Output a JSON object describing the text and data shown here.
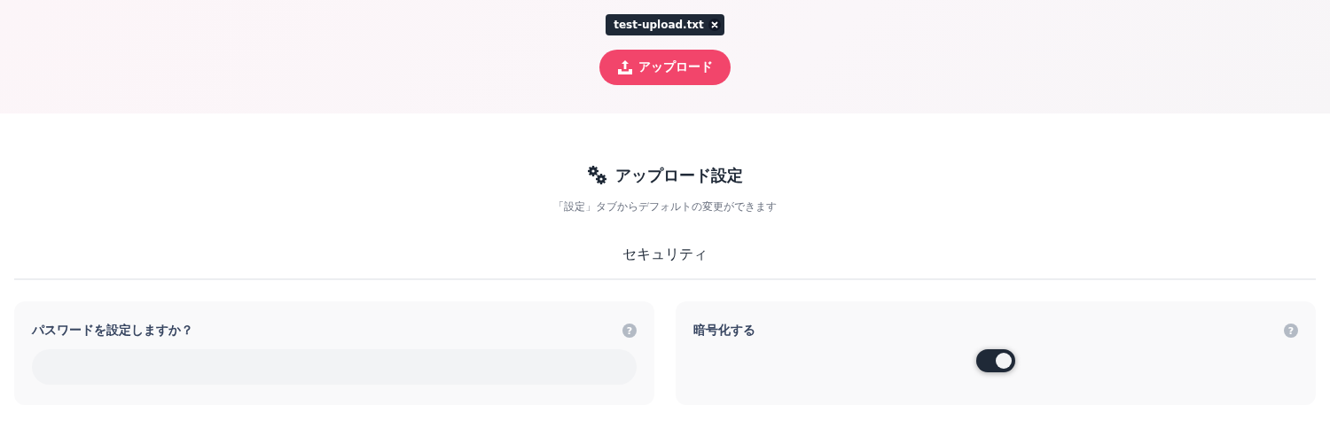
{
  "file_chip": {
    "name": "test-upload.txt"
  },
  "upload_button": {
    "label": "アップロード"
  },
  "settings": {
    "title": "アップロード設定",
    "subtitle": "「設定」タブからデフォルトの変更ができます",
    "section": "セキュリティ",
    "cards": [
      {
        "kind": "text",
        "label": "パスワードを設定しますか？",
        "help": "?"
      },
      {
        "kind": "toggle",
        "label": "暗号化する",
        "help": "?",
        "on": true
      }
    ]
  }
}
